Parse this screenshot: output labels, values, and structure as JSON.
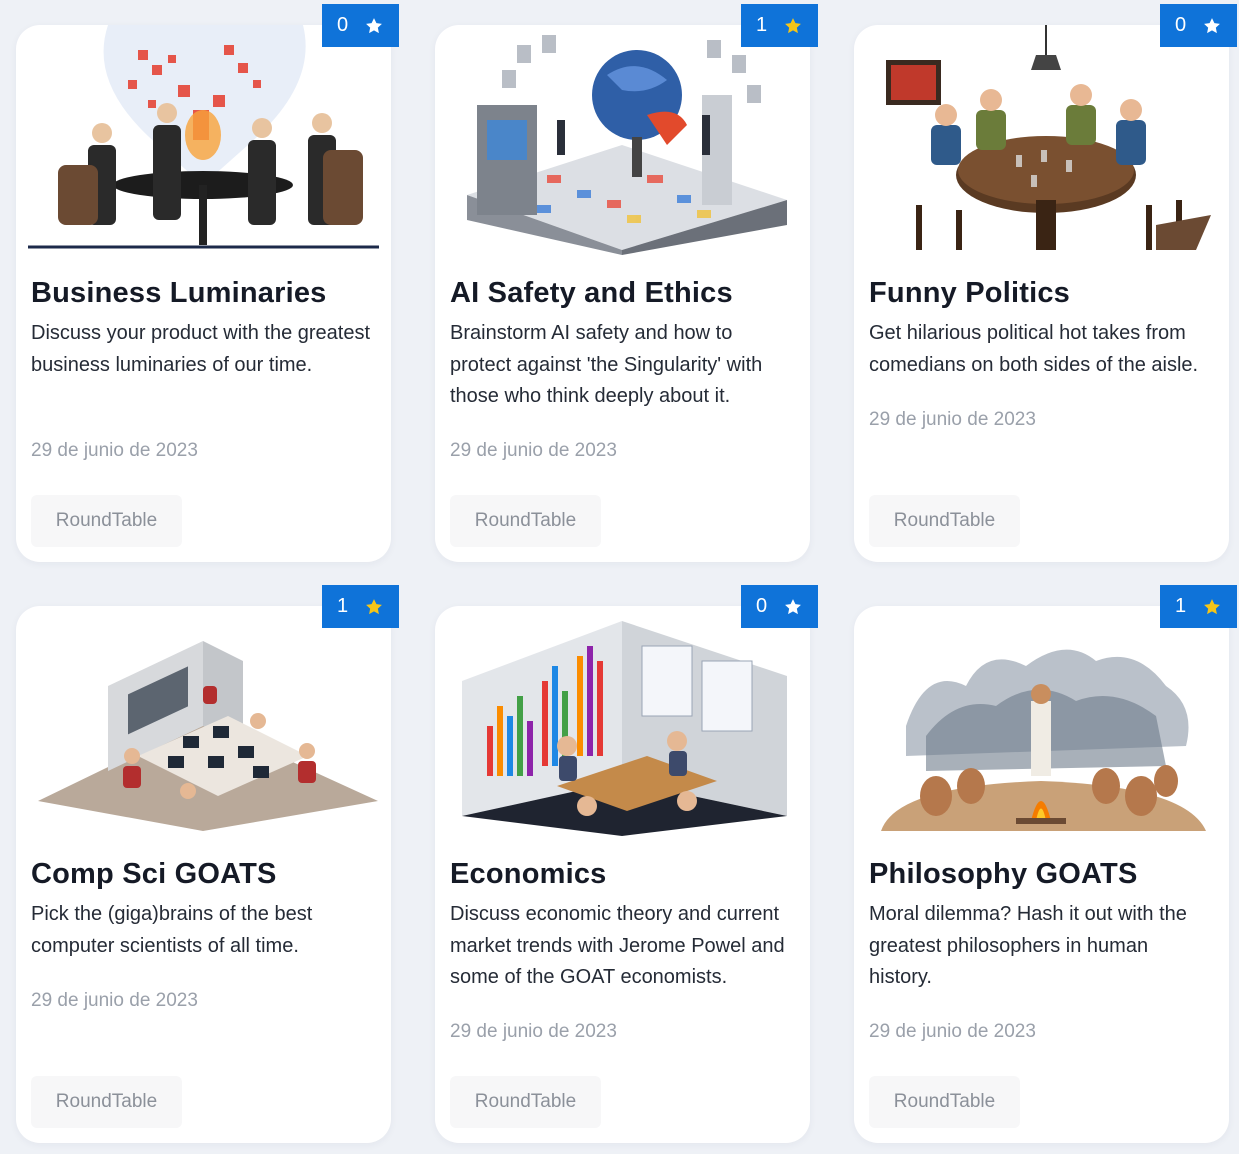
{
  "cards": [
    {
      "count": "0",
      "star_color": "#ffffff",
      "title": "Business Luminaries",
      "description": "Discuss your product with the greatest business luminaries of our time.",
      "date": "29 de junio de 2023",
      "tag": "RoundTable",
      "image_icon": "business-meeting-illustration"
    },
    {
      "count": "1",
      "star_color": "#f5c518",
      "title": "AI Safety and Ethics",
      "description": "Brainstorm AI safety and how to protect against 'the Singularity' with those who think deeply about it.",
      "date": "29 de junio de 2023",
      "tag": "RoundTable",
      "image_icon": "ai-globe-lab-illustration"
    },
    {
      "count": "0",
      "star_color": "#ffffff",
      "title": "Funny Politics",
      "description": "Get hilarious political hot takes from comedians on both sides of the aisle.",
      "date": "29 de junio de 2023",
      "tag": "RoundTable",
      "image_icon": "pub-table-illustration"
    },
    {
      "count": "1",
      "star_color": "#f5c518",
      "title": "Comp Sci GOATS",
      "description": "Pick the (giga)brains of the best computer scientists of all time.",
      "date": "29 de junio de 2023",
      "tag": "RoundTable",
      "image_icon": "computer-lab-illustration"
    },
    {
      "count": "0",
      "star_color": "#ffffff",
      "title": "Economics",
      "description": "Discuss economic theory and current market trends with Jerome Powel and some of the GOAT economists.",
      "date": "29 de junio de 2023",
      "tag": "RoundTable",
      "image_icon": "economics-room-illustration"
    },
    {
      "count": "1",
      "star_color": "#f5c518",
      "title": "Philosophy GOATS",
      "description": "Moral dilemma? Hash it out with the greatest philosophers in human history.",
      "date": "29 de junio de 2023",
      "tag": "RoundTable",
      "image_icon": "campfire-philosophers-illustration"
    }
  ]
}
